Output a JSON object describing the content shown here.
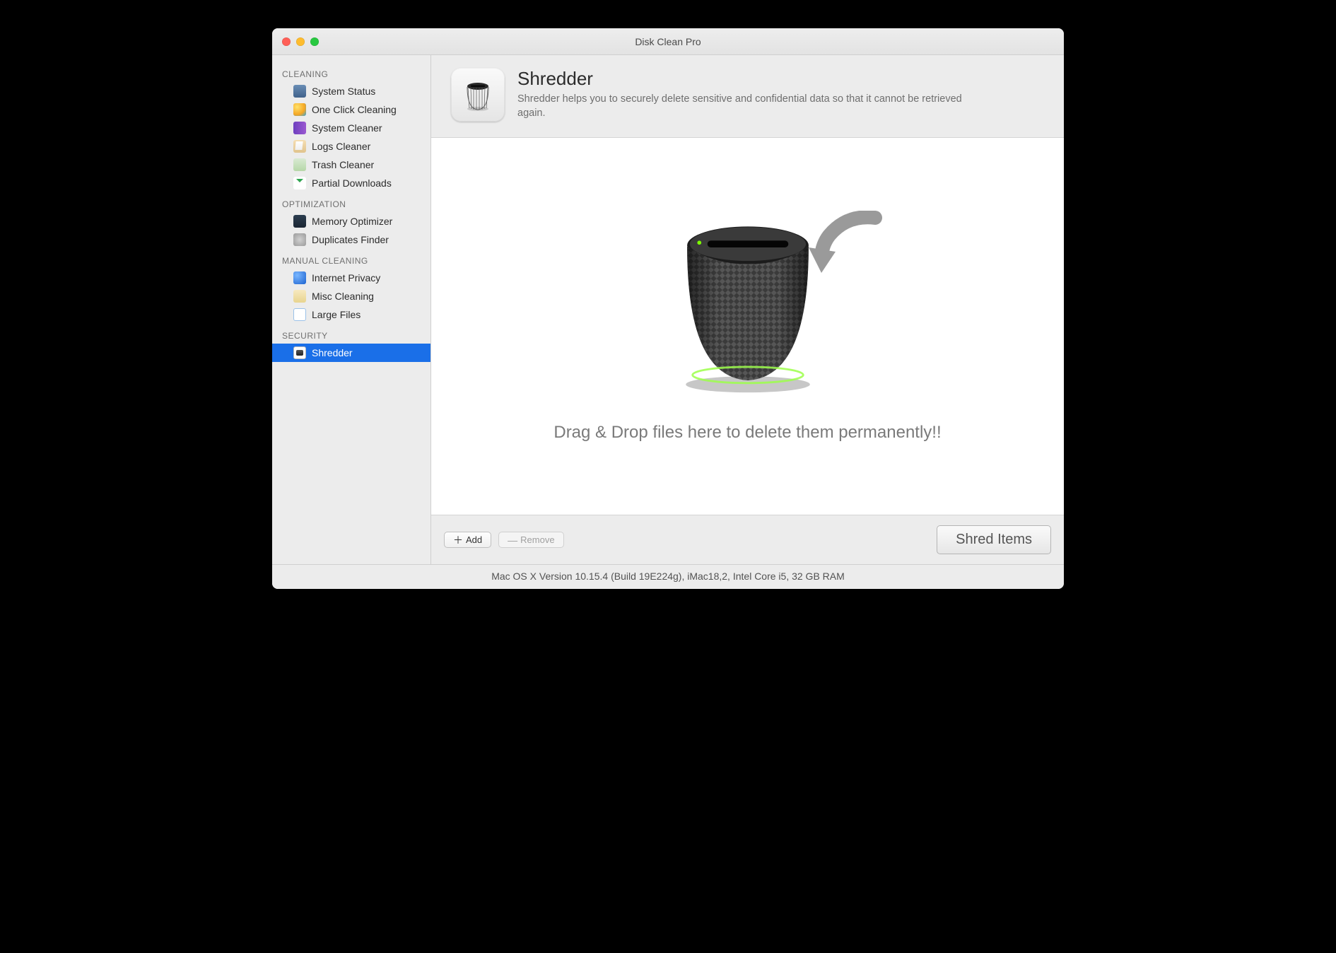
{
  "window": {
    "title": "Disk Clean Pro"
  },
  "sidebar": {
    "sections": [
      {
        "header": "CLEANING",
        "items": [
          {
            "label": "System Status",
            "icon": "monitor-icon"
          },
          {
            "label": "One Click Cleaning",
            "icon": "one-click-icon"
          },
          {
            "label": "System Cleaner",
            "icon": "system-cleaner-icon"
          },
          {
            "label": "Logs Cleaner",
            "icon": "logs-cleaner-icon"
          },
          {
            "label": "Trash Cleaner",
            "icon": "trash-cleaner-icon"
          },
          {
            "label": "Partial Downloads",
            "icon": "download-icon"
          }
        ]
      },
      {
        "header": "OPTIMIZATION",
        "items": [
          {
            "label": "Memory Optimizer",
            "icon": "memory-icon"
          },
          {
            "label": "Duplicates Finder",
            "icon": "duplicates-icon"
          }
        ]
      },
      {
        "header": "MANUAL CLEANING",
        "items": [
          {
            "label": "Internet Privacy",
            "icon": "globe-icon"
          },
          {
            "label": "Misc Cleaning",
            "icon": "misc-icon"
          },
          {
            "label": "Large Files",
            "icon": "large-files-icon"
          }
        ]
      },
      {
        "header": "SECURITY",
        "items": [
          {
            "label": "Shredder",
            "icon": "shredder-icon",
            "selected": true
          }
        ]
      }
    ]
  },
  "main": {
    "title": "Shredder",
    "subtitle": "Shredder helps you to securely delete sensitive and confidential data so that it cannot be retrieved again.",
    "drop_caption": "Drag & Drop files here to delete them permanently!!"
  },
  "toolbar": {
    "add_label": "Add",
    "remove_label": "Remove",
    "shred_label": "Shred Items"
  },
  "statusbar": {
    "text": "Mac OS X Version 10.15.4 (Build 19E224g), iMac18,2, Intel Core i5, 32 GB RAM"
  }
}
